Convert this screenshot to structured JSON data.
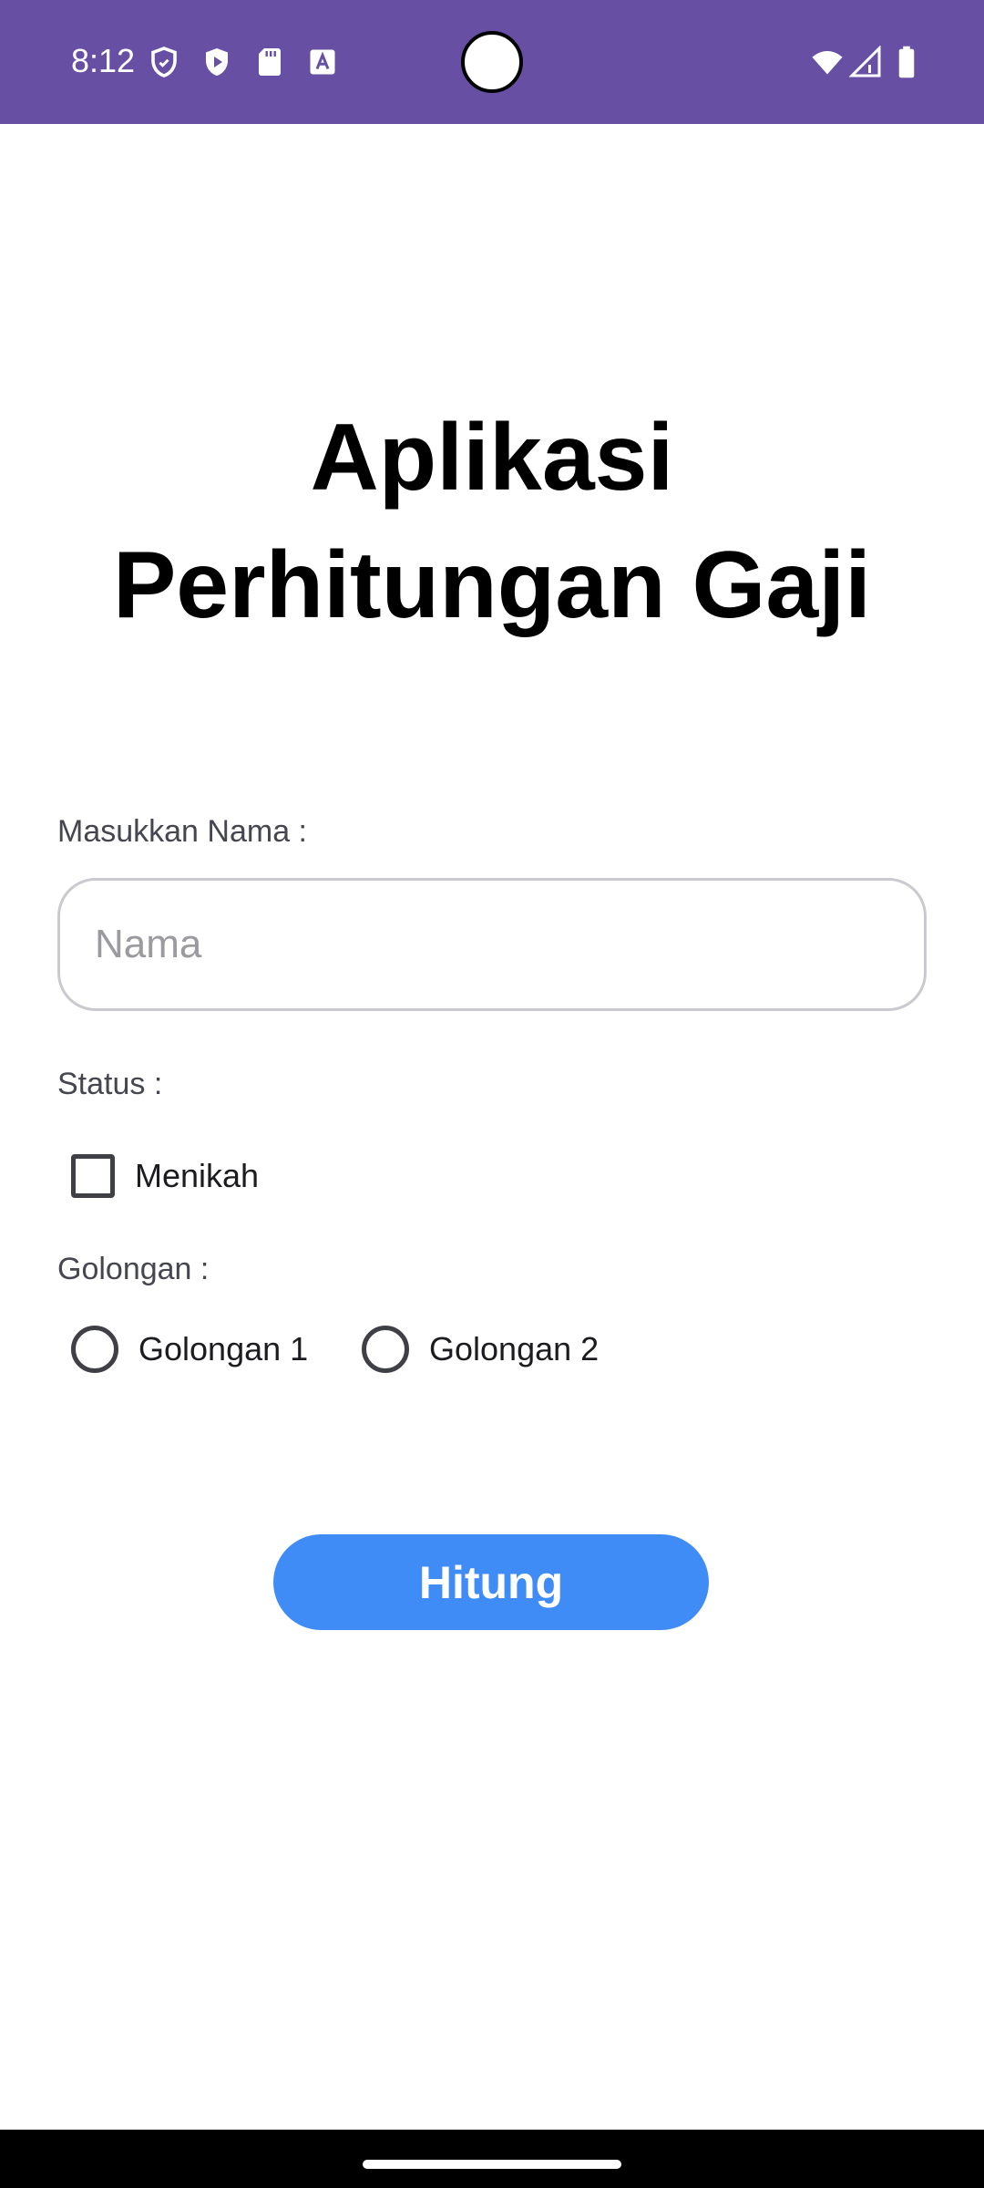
{
  "status_bar": {
    "time": "8:12",
    "icons_left": [
      "shield-outline-icon",
      "play-shield-icon",
      "sd-card-icon",
      "font-a-icon"
    ],
    "icons_right": [
      "wifi-icon",
      "signal-icon",
      "battery-icon"
    ],
    "background_color": "#6750A4"
  },
  "title": {
    "line1": "Aplikasi",
    "line2": "Perhitungan Gaji"
  },
  "form": {
    "nama_label": "Masukkan Nama :",
    "nama_placeholder": "Nama",
    "nama_value": "",
    "status_label": "Status :",
    "menikah_label": "Menikah",
    "menikah_checked": false,
    "golongan_label": "Golongan :",
    "golongan_options": [
      {
        "label": "Golongan 1",
        "selected": false
      },
      {
        "label": "Golongan 2",
        "selected": false
      }
    ]
  },
  "button": {
    "hitung_label": "Hitung",
    "color": "#3f8cf7"
  }
}
